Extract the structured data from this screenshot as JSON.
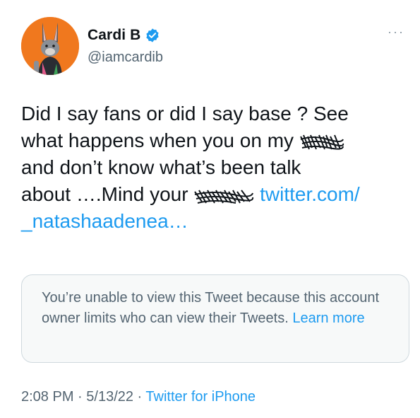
{
  "author": {
    "display_name": "Cardi B",
    "handle": "@iamcardib",
    "verified_icon": "verified-badge-icon",
    "avatar_icon": "bunny-avatar-icon"
  },
  "menu": {
    "more_icon": "more-options-icon",
    "more_label": "···"
  },
  "tweet": {
    "line1": "Did I say fans or did I say base ? See",
    "line2_start": "what happens when you on my ",
    "line3": "and don’t know what’s been talk",
    "line4_start": "about ….Mind your ",
    "link_part1": "twitter.com/",
    "link_part2": "_natashaadenea…"
  },
  "card": {
    "message": "You’re unable to view this Tweet because this account owner limits who can view their Tweets. ",
    "learn_more": "Learn more"
  },
  "meta": {
    "time": "2:08 PM",
    "separator": " · ",
    "date": "5/13/22",
    "separator2": " · ",
    "source": "Twitter for iPhone"
  },
  "colors": {
    "link": "#1d9bf0",
    "secondary_text": "#536471",
    "avatar_bg": "#f0781e",
    "card_bg": "#f7f9f9"
  }
}
